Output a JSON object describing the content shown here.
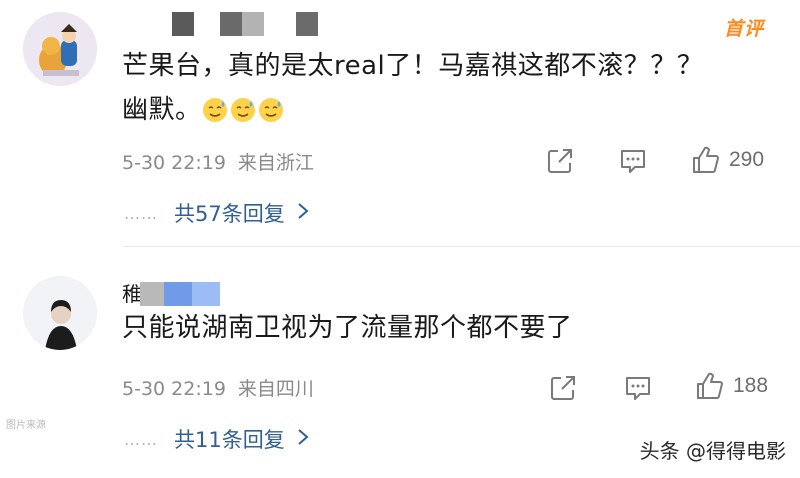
{
  "badge": "首评",
  "comments": [
    {
      "text_before_emoji": "芒果台，真的是太real了！马嘉祺这都不滚？？？",
      "text_line2": "幽默。",
      "emoji_count": 3,
      "emoji_name": "sweat-smile-emoji",
      "date": "5-30 22:19",
      "location": "来自浙江",
      "likes": "290",
      "replies": "共57条回复",
      "reply_dots": "……"
    },
    {
      "name_partial": "稚",
      "text": "只能说湖南卫视为了流量那个都不要了",
      "date": "5-30 22:19",
      "location": "来自四川",
      "likes": "188",
      "replies": "共11条回复",
      "reply_dots": "……"
    }
  ],
  "watermark": "头条 @得得电影",
  "left_watermark": "图片来源"
}
